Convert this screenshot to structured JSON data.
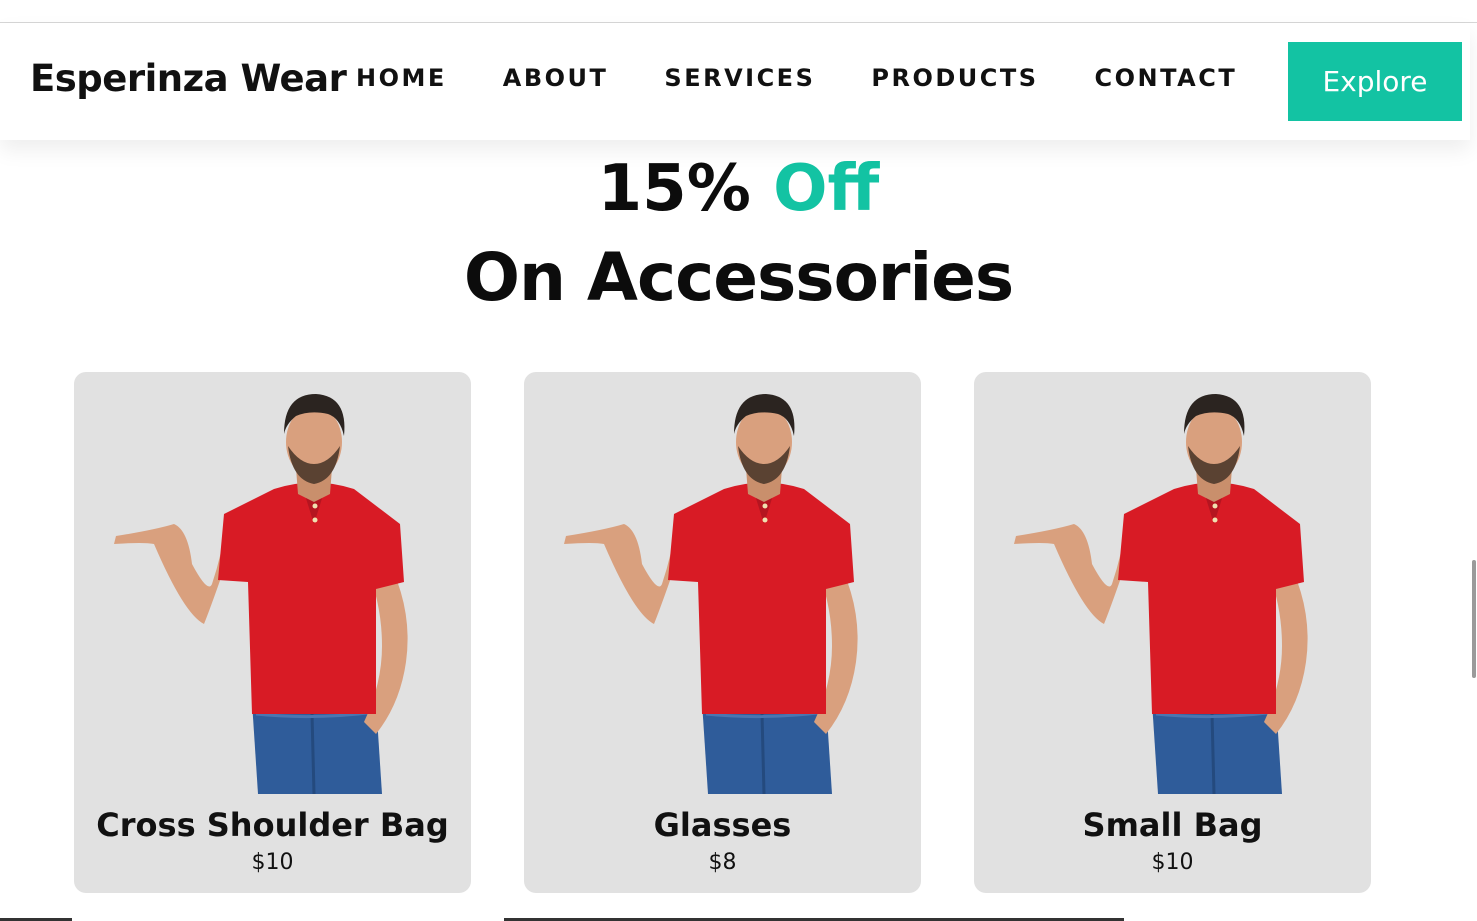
{
  "header": {
    "brand": "Esperinza Wear",
    "nav": [
      "HOME",
      "ABOUT",
      "SERVICES",
      "PRODUCTS",
      "CONTACT"
    ],
    "cta_label": "Explore"
  },
  "hero": {
    "discount": "15%",
    "discount_accent": "Off",
    "subtitle": "On Accessories"
  },
  "products": [
    {
      "name": "Cross Shoulder Bag",
      "price": "$10"
    },
    {
      "name": "Glasses",
      "price": "$8"
    },
    {
      "name": "Small Bag",
      "price": "$10"
    }
  ],
  "colors": {
    "accent": "#13c3a3",
    "card_bg": "#e1e1e1",
    "shirt": "#d81b25",
    "jeans": "#2f5c9a"
  }
}
